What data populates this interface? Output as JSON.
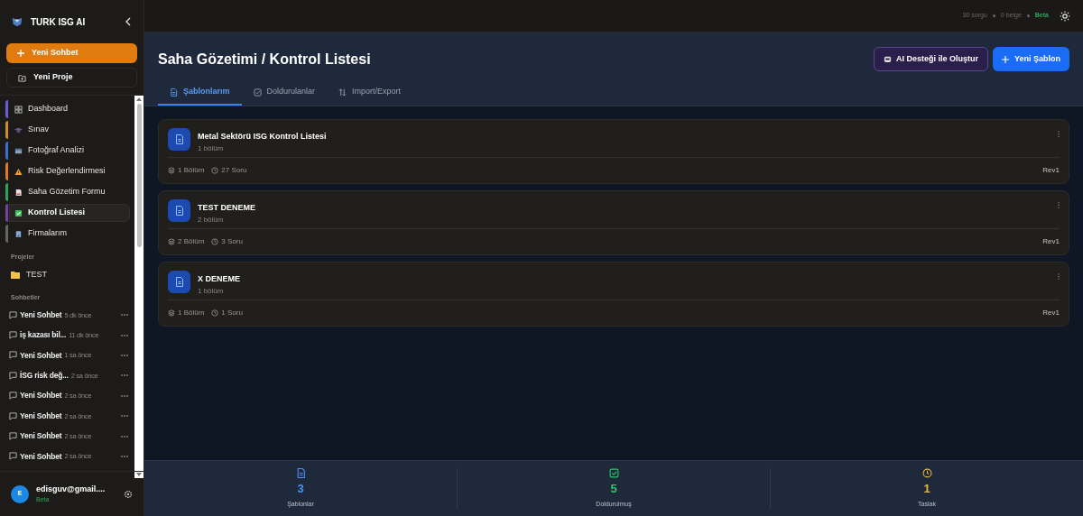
{
  "sidebar": {
    "brand": "TURK ISG AI",
    "new_chat": "Yeni Sohbet",
    "new_project": "Yeni Proje",
    "nav": [
      {
        "label": "Dashboard",
        "kind": "grid",
        "color": "#6d5bd0",
        "selected": false
      },
      {
        "label": "Sınav",
        "kind": "exam",
        "color": "#d08a2a",
        "selected": false
      },
      {
        "label": "Fotoğraf Analizi",
        "kind": "photo",
        "color": "#3b6fd0",
        "selected": false
      },
      {
        "label": "Risk Değerlendirmesi",
        "kind": "warning",
        "color": "#e0782a",
        "selected": false
      },
      {
        "label": "Saha Gözetim Formu",
        "kind": "form",
        "color": "#2fa35a",
        "selected": false
      },
      {
        "label": "Kontrol Listesi",
        "kind": "check",
        "color": "#7a3fa0",
        "selected": true
      },
      {
        "label": "Firmalarım",
        "kind": "building",
        "color": "#666666",
        "selected": false
      }
    ],
    "projects_heading": "Projeler",
    "projects": [
      {
        "label": "TEST"
      }
    ],
    "chats_heading": "Sohbetler",
    "chats": [
      {
        "title": "Yeni Sohbet",
        "time": "5 dk önce"
      },
      {
        "title": "iş kazası bil...",
        "time": "11 dk önce"
      },
      {
        "title": "Yeni Sohbet",
        "time": "1 sa önce"
      },
      {
        "title": "İSG risk değ...",
        "time": "2 sa önce"
      },
      {
        "title": "Yeni Sohbet",
        "time": "2 sa önce"
      },
      {
        "title": "Yeni Sohbet",
        "time": "2 sa önce"
      },
      {
        "title": "Yeni Sohbet",
        "time": "2 sa önce"
      },
      {
        "title": "Yeni Sohbet",
        "time": "2 sa önce"
      }
    ],
    "user": {
      "initial": "E",
      "email": "edisguv@gmail....",
      "plan": "Beta"
    }
  },
  "topbar": {
    "queries": "30 sorgu",
    "docs": "0 belge",
    "plan": "Beta"
  },
  "header": {
    "title": "Saha Gözetimi / Kontrol Listesi",
    "ai_button": "AI Desteği ile Oluştur",
    "new_button": "Yeni Şablon"
  },
  "tabs": [
    {
      "label": "Şablonlarım",
      "kind": "doc",
      "selected": true
    },
    {
      "label": "Doldurulanlar",
      "kind": "check",
      "selected": false
    },
    {
      "label": "Import/Export",
      "kind": "swap",
      "selected": false
    }
  ],
  "templates": [
    {
      "title": "Metal Sektörü ISG Kontrol Listesi",
      "subtitle": "1 bölüm",
      "sections": "1 Bölüm",
      "questions": "27 Soru",
      "revision": "Rev1"
    },
    {
      "title": "TEST DENEME",
      "subtitle": "2 bölüm",
      "sections": "2 Bölüm",
      "questions": "3 Soru",
      "revision": "Rev1"
    },
    {
      "title": "X DENEME",
      "subtitle": "1 bölüm",
      "sections": "1 Bölüm",
      "questions": "1 Soru",
      "revision": "Rev1"
    }
  ],
  "stats": [
    {
      "value": "3",
      "label": "Şablonlar",
      "kind": "doc",
      "color": "#4f8ff0"
    },
    {
      "value": "5",
      "label": "Doldurulmuş",
      "kind": "check",
      "color": "#2ec46a"
    },
    {
      "value": "1",
      "label": "Taslak",
      "kind": "clock",
      "color": "#e8b83a"
    }
  ]
}
